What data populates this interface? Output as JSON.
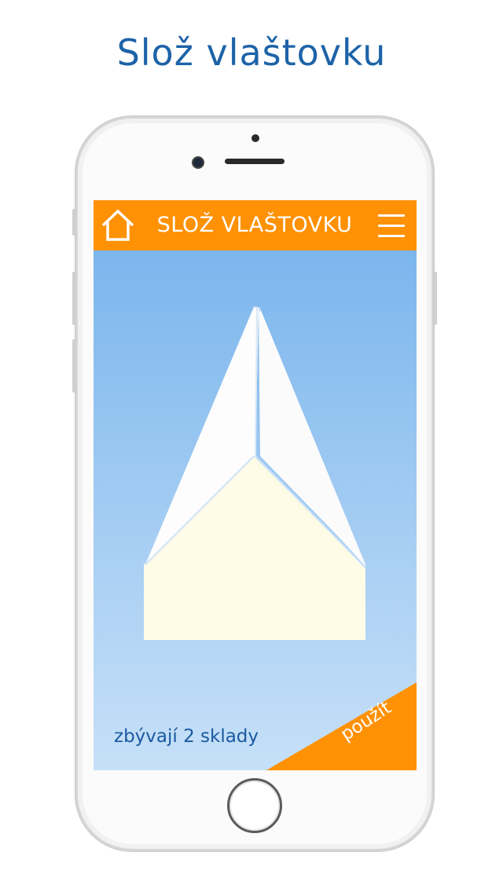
{
  "promo": {
    "title": "Slož vlaštovku"
  },
  "appbar": {
    "title": "SLOŽ VLAŠTOVKU",
    "home_icon": "home-icon",
    "menu_icon": "hamburger-menu-icon"
  },
  "main": {
    "status_text": "zbývají 2 sklady",
    "use_label": "použít"
  },
  "colors": {
    "brand_orange": "#ff9105",
    "title_blue": "#1d63a8",
    "status_blue": "#1b5aa0",
    "sky_top": "#74b2ec",
    "sky_bottom": "#c6e0f8",
    "paper_white": "#ffffff",
    "paper_cream": "#fefbe6"
  }
}
